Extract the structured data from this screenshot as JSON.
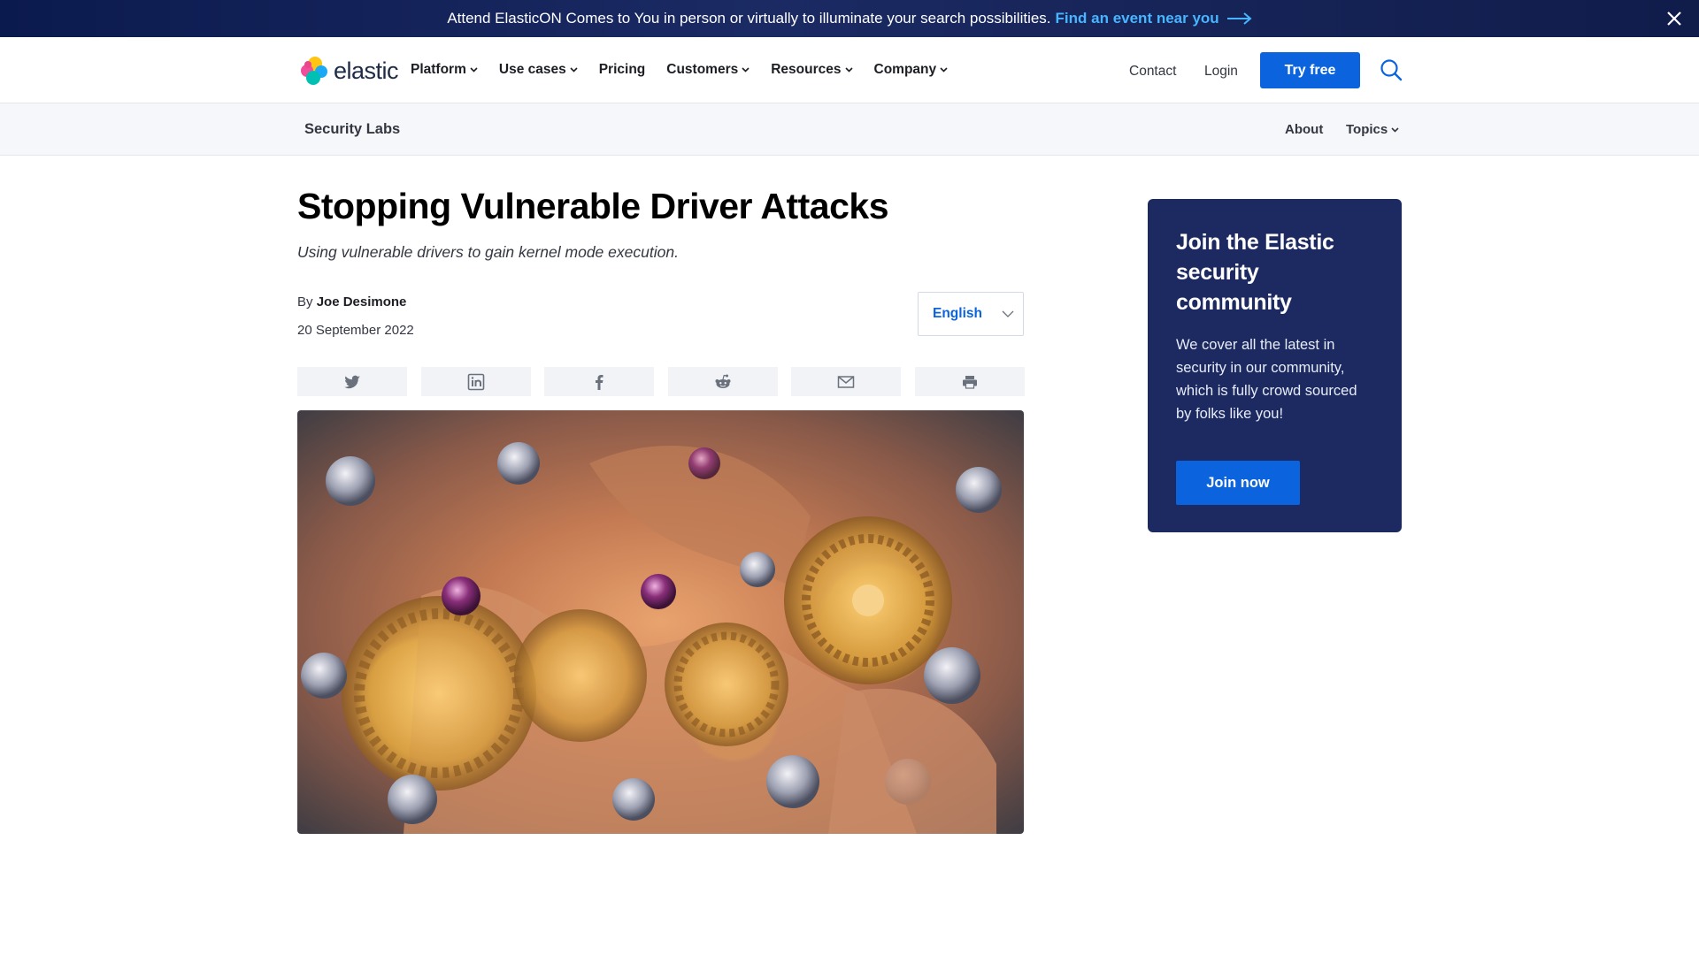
{
  "banner": {
    "message": "Attend ElasticON Comes to You in person or virtually to illuminate your search possibilities.",
    "link_text": "Find an event near you"
  },
  "nav": {
    "logo_text": "elastic",
    "items": [
      {
        "label": "Platform"
      },
      {
        "label": "Use cases"
      },
      {
        "label": "Pricing"
      },
      {
        "label": "Customers"
      },
      {
        "label": "Resources"
      },
      {
        "label": "Company"
      }
    ],
    "contact": "Contact",
    "login": "Login",
    "try_free": "Try free"
  },
  "subnav": {
    "title": "Security Labs",
    "about": "About",
    "topics": "Topics"
  },
  "article": {
    "title": "Stopping Vulnerable Driver Attacks",
    "subtitle": "Using vulnerable drivers to gain kernel mode execution.",
    "by": "By",
    "author": "Joe Desimone",
    "date": "20 September 2022",
    "language": "English",
    "share_icons": [
      "twitter-icon",
      "linkedin-icon",
      "facebook-icon",
      "reddit-icon",
      "email-icon",
      "print-icon"
    ]
  },
  "card": {
    "heading": "Join the Elastic security community",
    "body": "We cover all the latest in security in our community, which is fully crowd sourced by folks like you!",
    "button": "Join now"
  },
  "colors": {
    "banner_bg": "#0b1a4e",
    "banner_link": "#48b5ff",
    "primary": "#0b64dd",
    "card_bg": "#1c2a61"
  }
}
